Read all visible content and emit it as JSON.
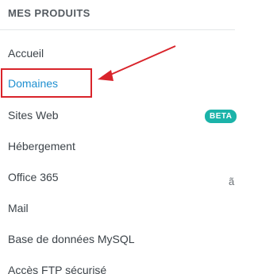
{
  "section": {
    "title": "MES PRODUITS"
  },
  "nav": {
    "items": [
      {
        "label": "Accueil"
      },
      {
        "label": "Domaines",
        "active": true
      },
      {
        "label": "Sites Web",
        "badge": "BETA"
      },
      {
        "label": "Hébergement"
      },
      {
        "label": "Office 365",
        "trailing_glyph": "ã"
      },
      {
        "label": "Mail"
      },
      {
        "label": "Base de données MySQL"
      },
      {
        "label": "Accès FTP sécurisé"
      }
    ]
  },
  "annotation": {
    "color": "#d9242b"
  },
  "colors": {
    "active_link": "#1e8fd0",
    "text": "#3c4349",
    "badge_bg": "#1bb3a9",
    "title": "#555b61"
  }
}
